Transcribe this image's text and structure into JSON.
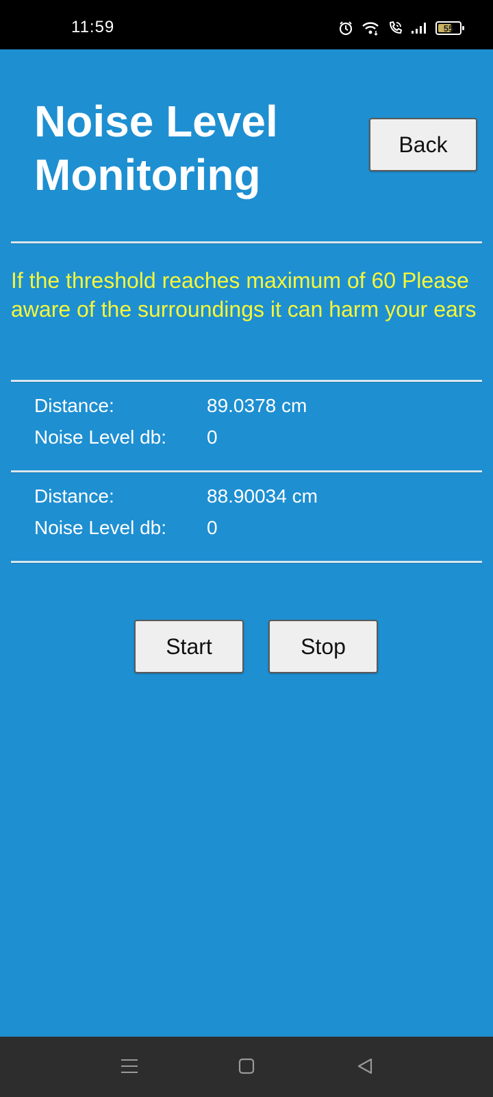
{
  "status_bar": {
    "time": "11:59",
    "battery_level": "55"
  },
  "header": {
    "title": "Noise Level Monitoring",
    "back_label": "Back"
  },
  "warning_text": "If the threshold reaches maximum of 60 Please aware of the surroundings it can harm your ears",
  "readings": [
    {
      "distance_label": "Distance:",
      "distance_value": "89.0378 cm",
      "noise_label": "Noise Level db:",
      "noise_value": "0"
    },
    {
      "distance_label": "Distance:",
      "distance_value": "88.90034 cm",
      "noise_label": "Noise Level db:",
      "noise_value": "0"
    }
  ],
  "controls": {
    "start_label": "Start",
    "stop_label": "Stop"
  },
  "colors": {
    "background": "#1e8fd1",
    "warning": "#f6f63a",
    "button": "#efefef"
  }
}
